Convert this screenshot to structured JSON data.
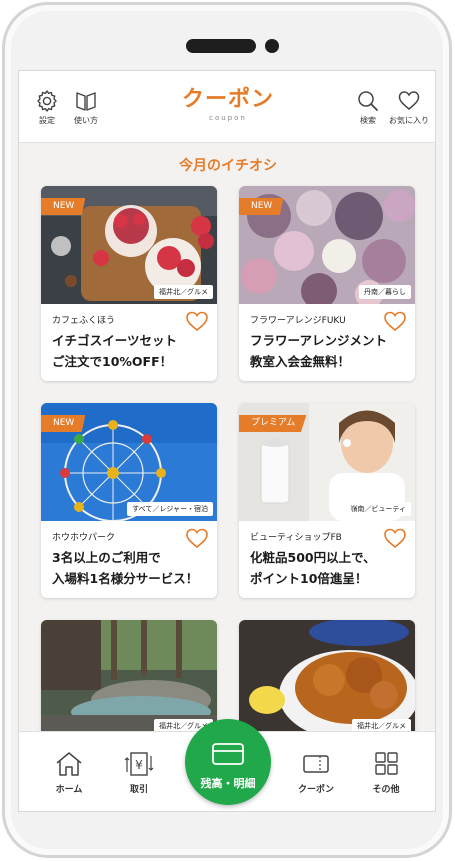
{
  "header": {
    "settings_label": "設定",
    "howto_label": "使い方",
    "logo_title": "クーポン",
    "logo_sub": "coupon",
    "search_label": "検索",
    "favorites_label": "お気に入り"
  },
  "section_title": "今月のイチオシ",
  "cards": [
    {
      "badge": "NEW",
      "location": "福井北／グルメ",
      "shop": "カフェふくほう",
      "offer_line1": "イチゴスイーツセット",
      "offer_line2": "ご注文で10%OFF！"
    },
    {
      "badge": "NEW",
      "location": "丹南／暮らし",
      "shop": "フラワーアレンジFUKU",
      "offer_line1": "フラワーアレンジメント",
      "offer_line2": "教室入会金無料！"
    },
    {
      "badge": "NEW",
      "location": "すべて／レジャー・宿泊",
      "shop": "ホウホウパーク",
      "offer_line1": "3名以上のご利用で",
      "offer_line2": "入場料1名様分サービス！"
    },
    {
      "badge": "プレミアム",
      "location": "嶺南／ビューティ",
      "shop": "ビューティショップFB",
      "offer_line1": "化粧品500円以上で、",
      "offer_line2": "ポイント10倍進呈！"
    },
    {
      "badge": "",
      "location": "福井北／グルメ",
      "shop": "",
      "offer_line1": "",
      "offer_line2": ""
    },
    {
      "badge": "",
      "location": "福井北／グルメ",
      "shop": "",
      "offer_line1": "",
      "offer_line2": ""
    }
  ],
  "bottom_nav": {
    "home_label": "ホーム",
    "transactions_label": "取引",
    "balance_label": "残高・明細",
    "coupon_label": "クーポン",
    "other_label": "その他"
  },
  "colors": {
    "accent": "#e57c2a",
    "balance_button": "#20a84a"
  }
}
